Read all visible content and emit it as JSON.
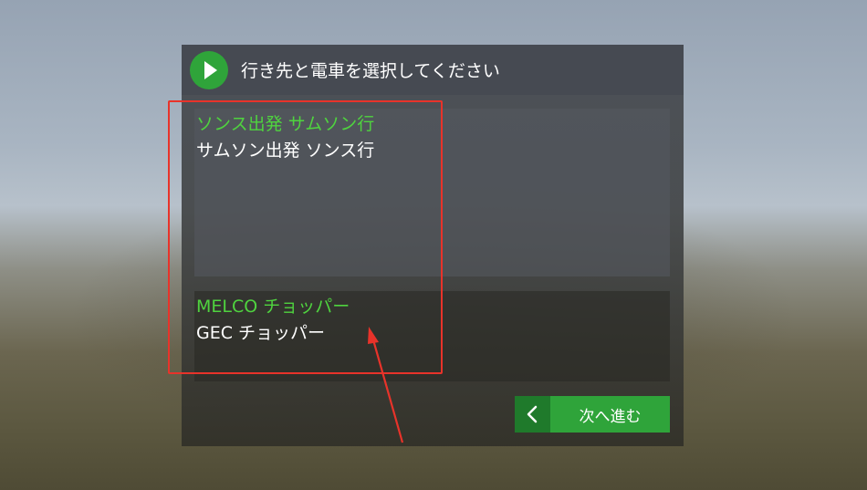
{
  "dialog": {
    "title": "行き先と電車を選択してください",
    "play_icon": "play-icon",
    "accent_color": "#2fa43a",
    "options": [
      {
        "destination": "ソンス出発 サムソン行",
        "alternate": "サムソン出発 ソンス行"
      },
      {
        "destination": "MELCO チョッパー",
        "alternate": "GEC チョッパー"
      }
    ],
    "back_icon": "chevron-left-icon",
    "next_label": "次へ進む"
  },
  "annotation": {
    "box_color": "#e8332a",
    "arrow_icon": "arrow-up-icon"
  }
}
